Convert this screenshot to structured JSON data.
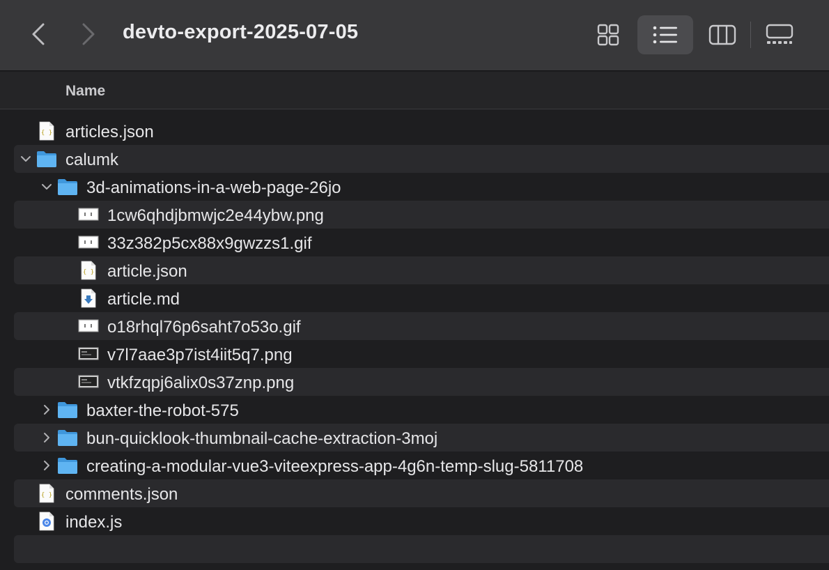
{
  "window": {
    "title": "devto-export-2025-07-05"
  },
  "toolbar": {
    "back_icon": "chevron-left-icon",
    "forward_icon": "chevron-right-icon",
    "view_modes": [
      "icons",
      "list",
      "columns",
      "gallery"
    ],
    "active_view": "list"
  },
  "column_header": {
    "name": "Name"
  },
  "files": [
    {
      "name": "articles.json",
      "kind": "json",
      "level": 0,
      "expandable": false
    },
    {
      "name": "calumk",
      "kind": "folder",
      "level": 0,
      "expandable": true,
      "expanded": true
    },
    {
      "name": "3d-animations-in-a-web-page-26jo",
      "kind": "folder",
      "level": 1,
      "expandable": true,
      "expanded": true
    },
    {
      "name": "1cw6qhdjbmwjc2e44ybw.png",
      "kind": "image",
      "level": 2,
      "expandable": false
    },
    {
      "name": "33z382p5cx88x9gwzzs1.gif",
      "kind": "image",
      "level": 2,
      "expandable": false
    },
    {
      "name": "article.json",
      "kind": "json",
      "level": 2,
      "expandable": false
    },
    {
      "name": "article.md",
      "kind": "markdown",
      "level": 2,
      "expandable": false
    },
    {
      "name": "o18rhql76p6saht7o53o.gif",
      "kind": "image",
      "level": 2,
      "expandable": false
    },
    {
      "name": "v7l7aae3p7ist4iit5q7.png",
      "kind": "image-dark",
      "level": 2,
      "expandable": false
    },
    {
      "name": "vtkfzqpj6alix0s37znp.png",
      "kind": "image-dark",
      "level": 2,
      "expandable": false
    },
    {
      "name": "baxter-the-robot-575",
      "kind": "folder",
      "level": 1,
      "expandable": true,
      "expanded": false
    },
    {
      "name": "bun-quicklook-thumbnail-cache-extraction-3moj",
      "kind": "folder",
      "level": 1,
      "expandable": true,
      "expanded": false
    },
    {
      "name": "creating-a-modular-vue3-viteexpress-app-4g6n-temp-slug-5811708",
      "kind": "folder",
      "level": 1,
      "expandable": true,
      "expanded": false
    },
    {
      "name": "comments.json",
      "kind": "json",
      "level": 0,
      "expandable": false
    },
    {
      "name": "index.js",
      "kind": "js",
      "level": 0,
      "expandable": false
    }
  ],
  "colors": {
    "toolbar_bg": "#38383a",
    "window_bg": "#1e1e20",
    "row_alt": "#2a2a2d",
    "folder_blue": "#5fb4f2"
  }
}
